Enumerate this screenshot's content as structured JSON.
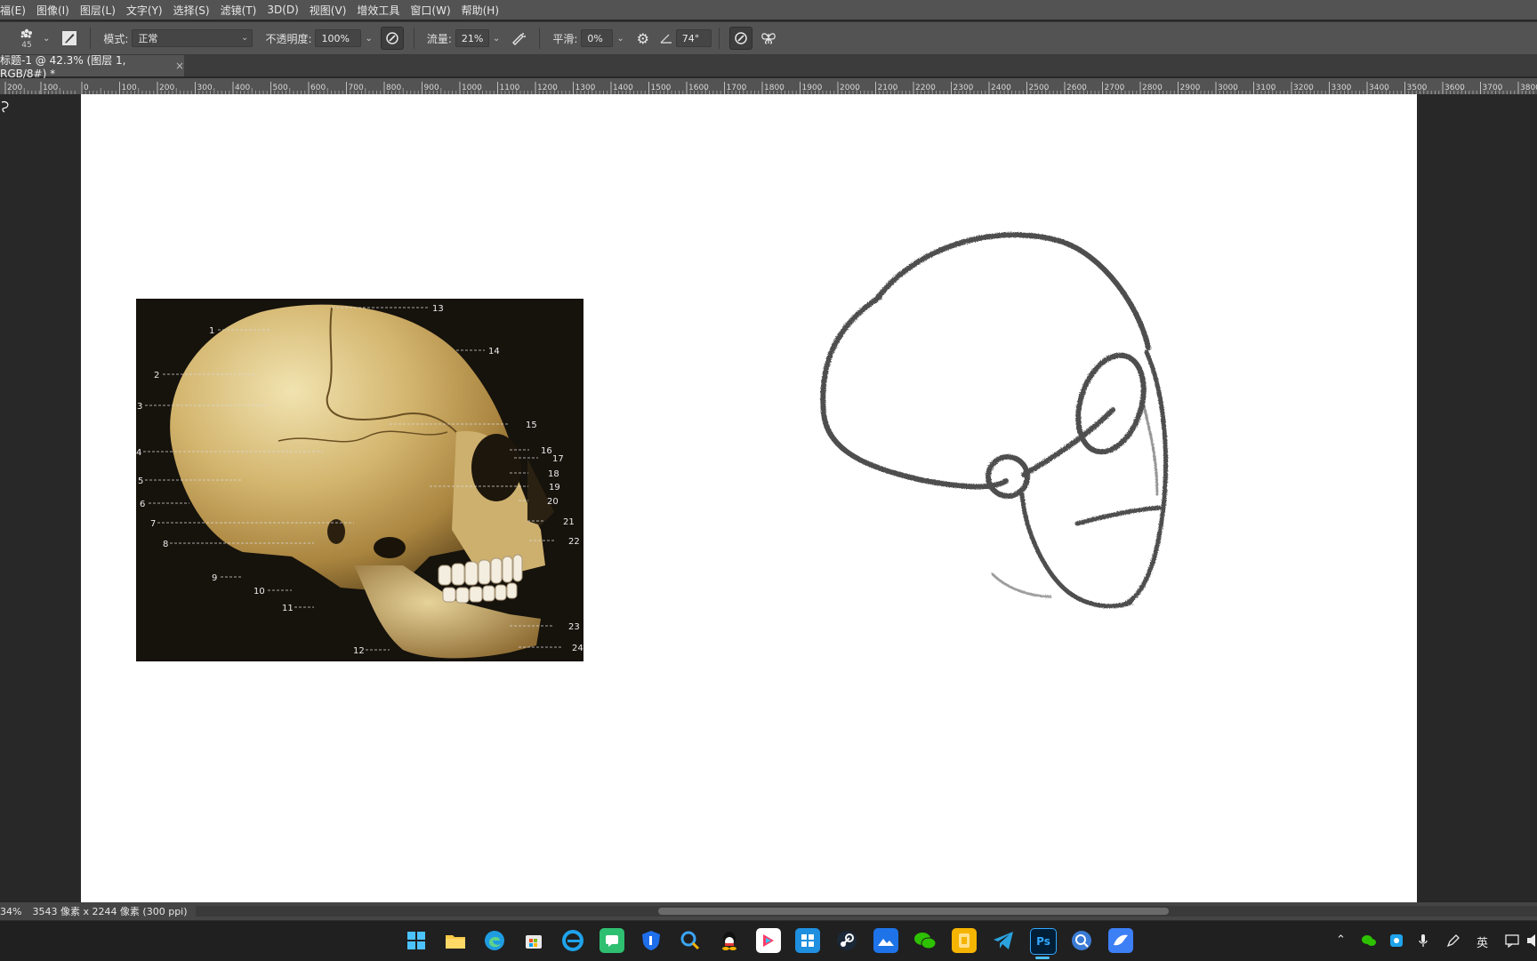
{
  "menu": [
    "福(E)",
    "图像(I)",
    "图层(L)",
    "文字(Y)",
    "选择(S)",
    "滤镜(T)",
    "3D(D)",
    "视图(V)",
    "增效工具",
    "窗口(W)",
    "帮助(H)"
  ],
  "options": {
    "brush_size": "45",
    "mode_label": "模式:",
    "mode_value": "正常",
    "opacity_label": "不透明度:",
    "opacity_value": "100%",
    "flow_label": "流量:",
    "flow_value": "21%",
    "smoothing_label": "平滑:",
    "smoothing_value": "0%",
    "angle_value": "74°"
  },
  "document_tab": {
    "title": "标题-1 @ 42.3% (图层 1, RGB/8#) *",
    "close": "×"
  },
  "ruler": {
    "labels": [
      "200",
      "100",
      "0",
      "100",
      "200",
      "300",
      "400",
      "500",
      "600",
      "700",
      "800",
      "900",
      "1000",
      "1100",
      "1200",
      "1300",
      "1400",
      "1500",
      "1600",
      "1700",
      "1800",
      "1900",
      "2000",
      "2100",
      "2200",
      "2300",
      "2400",
      "2500",
      "2600",
      "2700",
      "2800",
      "2900",
      "3000",
      "3100",
      "3200",
      "3300",
      "3400",
      "3500",
      "3600",
      "3700",
      "3800"
    ]
  },
  "reference_image": {
    "labels": [
      "1",
      "2",
      "3",
      "4",
      "5",
      "6",
      "7",
      "8",
      "9",
      "10",
      "11",
      "12",
      "13",
      "14",
      "15",
      "16",
      "17",
      "18",
      "19",
      "20",
      "21",
      "22",
      "23",
      "24"
    ]
  },
  "status": {
    "zoom": "34%",
    "doc_info": "3543 像素 x 2244 像素 (300 ppi)",
    "arrow": "›",
    "back": "‹"
  },
  "tray": {
    "ime": "英"
  },
  "colors": {
    "app_bg": "#282828",
    "panel": "#535353",
    "canvas": "#ffffff",
    "taskbar": "#202020"
  }
}
